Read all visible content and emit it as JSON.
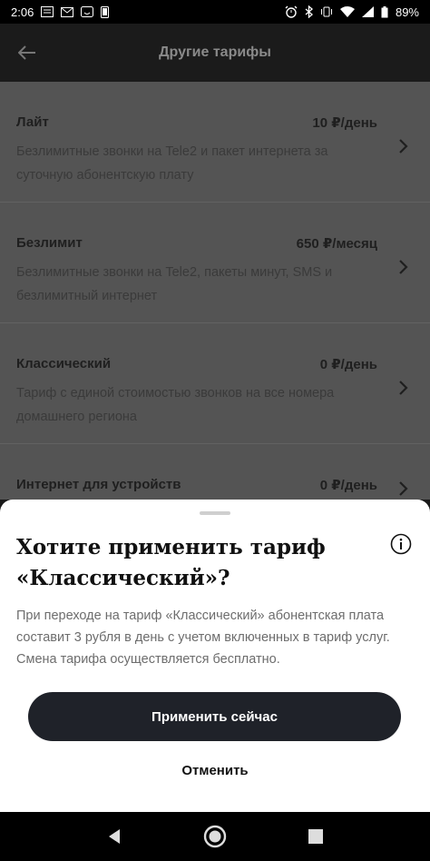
{
  "status_bar": {
    "time": "2:06",
    "battery": "89%"
  },
  "app_bar": {
    "title": "Другие тарифы"
  },
  "tariffs": [
    {
      "name": "Лайт",
      "price": "10 ₽/день",
      "description": "Безлимитные звонки на Tele2 и пакет интернета за суточную абонентскую плату"
    },
    {
      "name": "Безлимит",
      "price": "650 ₽/месяц",
      "description": "Безлимитные звонки на Tele2, пакеты минут, SMS и безлимитный интернет"
    },
    {
      "name": "Классический",
      "price": "0 ₽/день",
      "description": "Тариф с единой стоимостью звонков на все номера домашнего региона"
    },
    {
      "name": "Интернет для устройств",
      "price": "0 ₽/день",
      "description": ""
    }
  ],
  "dialog": {
    "title": "Хотите применить тариф «Классический»?",
    "text": "При переходе на тариф «Классический» абонентская плата составит 3 рубля в день с учетом включенных в тариф услуг. Смена тарифа осуществляется бесплатно.",
    "apply_label": "Применить сейчас",
    "cancel_label": "Отменить"
  },
  "colors": {
    "overlay": "#545454",
    "button_dark": "#1f2229",
    "sheet_bg": "#ffffff"
  },
  "icons": [
    "back-arrow-icon",
    "info-icon",
    "chevron-right-icon",
    "nav-back-icon",
    "nav-home-icon",
    "nav-recents-icon"
  ]
}
